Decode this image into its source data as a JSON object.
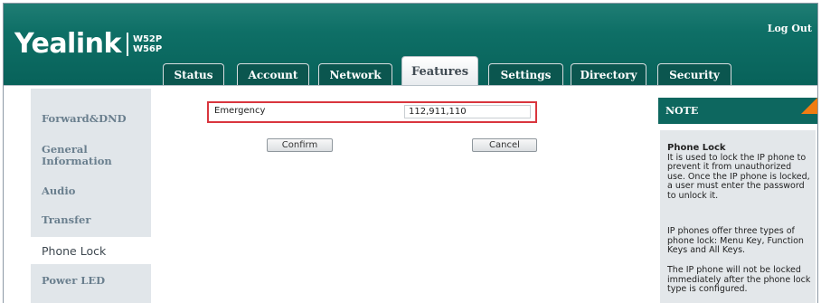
{
  "header": {
    "logo_text": "Yealink",
    "models": [
      "W52P",
      "W56P"
    ],
    "logout": "Log Out"
  },
  "tabs": [
    {
      "label": "Status",
      "active": false
    },
    {
      "label": "Account",
      "active": false
    },
    {
      "label": "Network",
      "active": false
    },
    {
      "label": "Features",
      "active": true
    },
    {
      "label": "Settings",
      "active": false
    },
    {
      "label": "Directory",
      "active": false
    },
    {
      "label": "Security",
      "active": false
    }
  ],
  "sidebar": {
    "items": [
      {
        "label": "Forward&DND",
        "active": false
      },
      {
        "label": "General Information",
        "active": false
      },
      {
        "label": "Audio",
        "active": false
      },
      {
        "label": "Transfer",
        "active": false
      },
      {
        "label": "Phone Lock",
        "active": true
      },
      {
        "label": "Power LED",
        "active": false
      }
    ]
  },
  "form": {
    "emergency_label": "Emergency",
    "emergency_value": "112,911,110",
    "confirm": "Confirm",
    "cancel": "Cancel"
  },
  "note": {
    "header": "NOTE",
    "title": "Phone Lock",
    "para1": "It is used to lock the IP phone to prevent it from unauthorized use. Once the IP phone is locked, a user must enter the password to unlock it.",
    "para2": "IP phones offer three types of phone lock: Menu Key, Function Keys and All Keys.",
    "para3": "The IP phone will not be locked immediately after the phone lock type is configured."
  },
  "colors": {
    "header_teal": "#0e6f66",
    "highlight_border": "#d9363e",
    "note_corner": "#f07c12"
  }
}
